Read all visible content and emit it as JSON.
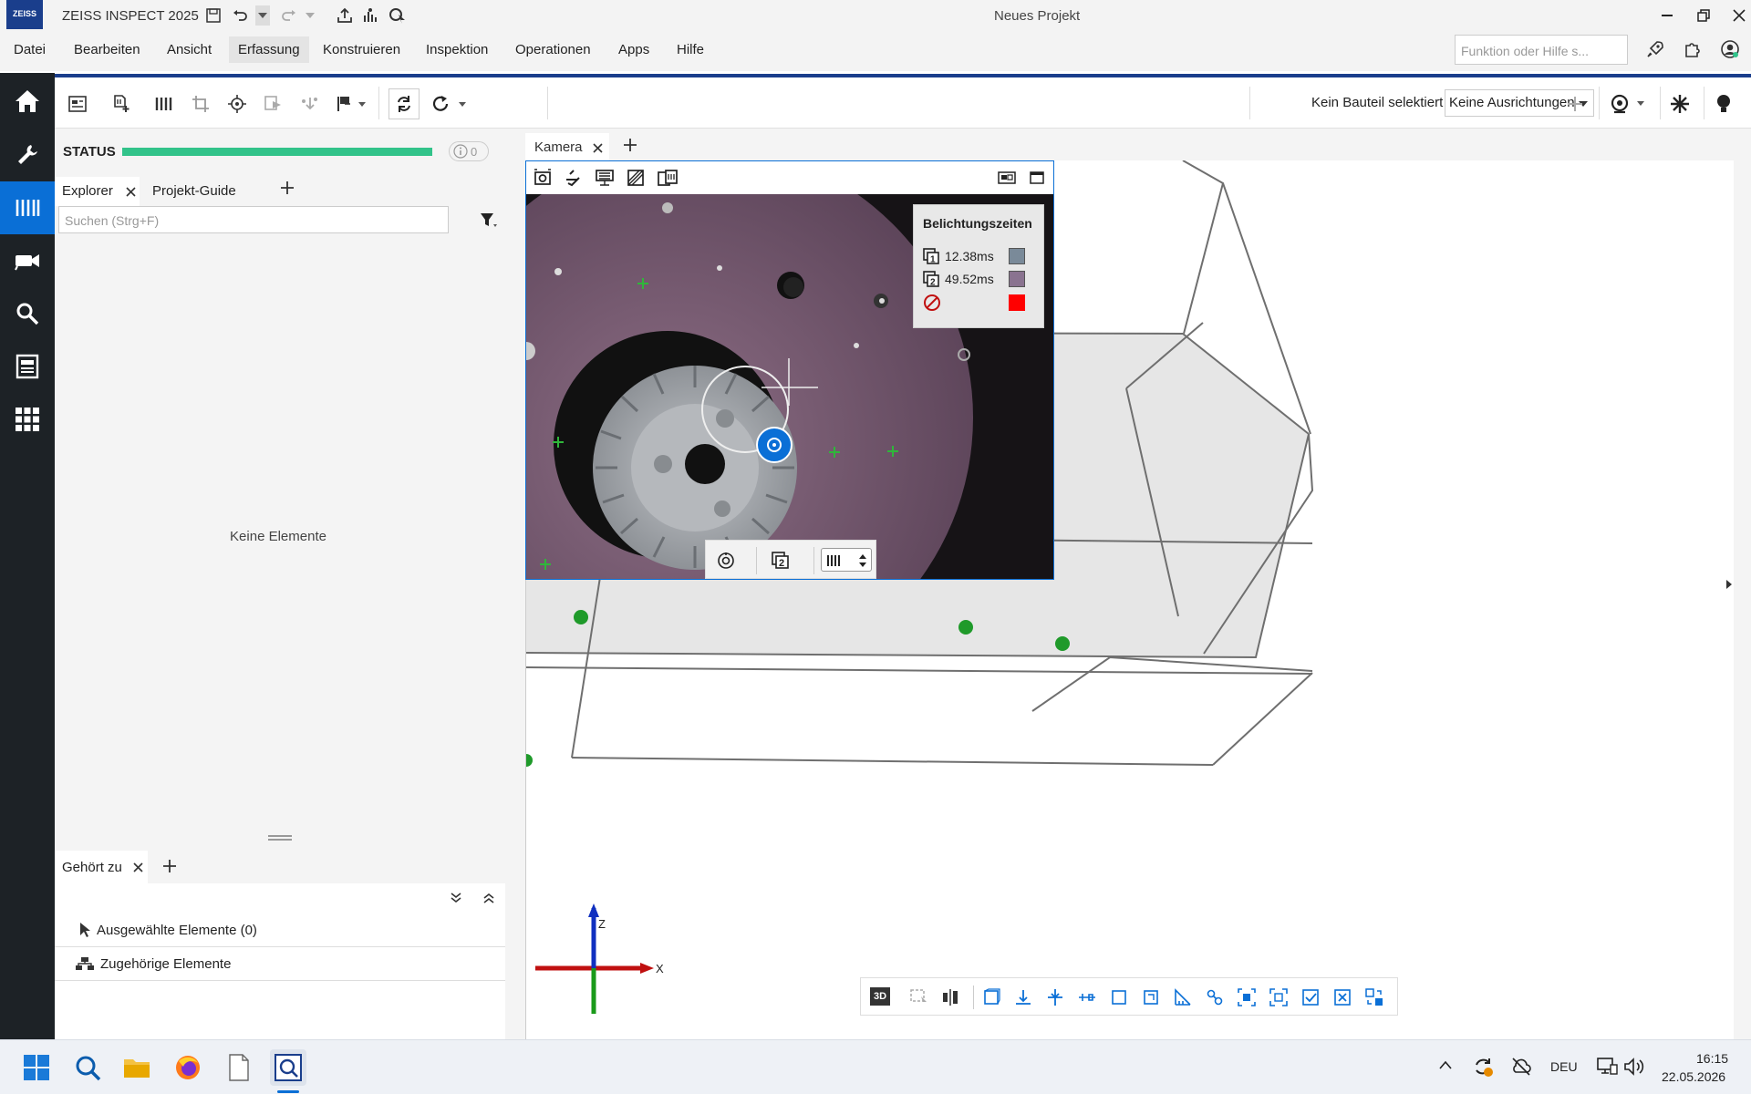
{
  "app": {
    "logo_text": "ZEISS",
    "title": "ZEISS INSPECT 2025",
    "document_title": "Neues Projekt"
  },
  "menu": {
    "items": [
      "Datei",
      "Bearbeiten",
      "Ansicht",
      "Erfassung",
      "Konstruieren",
      "Inspektion",
      "Operationen",
      "Apps",
      "Hilfe"
    ],
    "active": "Erfassung",
    "search_placeholder": "Funktion oder Hilfe s..."
  },
  "toolbar": {
    "part_status": "Kein Bauteil selektiert",
    "alignment_select": "Keine Ausrichtungen"
  },
  "status": {
    "label": "STATUS",
    "progress": 1.0,
    "info_count": "0"
  },
  "explorer": {
    "tabs": [
      "Explorer",
      "Projekt-Guide"
    ],
    "search_placeholder": "Suchen (Strg+F)",
    "empty_text": "Keine Elemente"
  },
  "belongs_to": {
    "tab": "Gehört zu",
    "selected_elements": "Ausgewählte Elemente (0)",
    "related_elements": "Zugehörige Elemente"
  },
  "camera": {
    "tab": "Kamera",
    "exposure_title": "Belichtungszeiten",
    "exposures": [
      {
        "index": "1",
        "time": "12.38ms",
        "color": "#7a8a99"
      },
      {
        "index": "2",
        "time": "49.52ms",
        "color": "#8a7390"
      },
      {
        "index": "",
        "time": "",
        "color": "#ff0000"
      }
    ]
  },
  "axes": {
    "x": "X",
    "z": "Z"
  },
  "view_mode": "3D",
  "taskbar": {
    "language": "DEU",
    "time": "16:15",
    "date": "22.05.2026"
  }
}
